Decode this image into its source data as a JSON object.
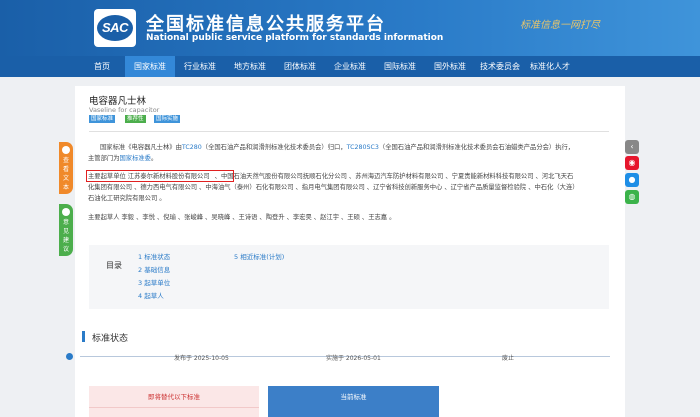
{
  "site": {
    "logo_text": "SAC",
    "title": "全国标准信息公共服务平台",
    "subtitle": "National public service platform  for standards information",
    "slogan": "标准信息一网打尽"
  },
  "nav": {
    "items": [
      {
        "label": "首页"
      },
      {
        "label": "国家标准"
      },
      {
        "label": "行业标准"
      },
      {
        "label": "地方标准"
      },
      {
        "label": "团体标准"
      },
      {
        "label": "企业标准"
      },
      {
        "label": "国际标准"
      },
      {
        "label": "国外标准"
      },
      {
        "label": "技术委员会"
      },
      {
        "label": "标准化人才"
      }
    ],
    "active_index": 1
  },
  "standard": {
    "title": "电容器凡士林",
    "title_en": "Vaseline for capacitor",
    "tags": [
      {
        "label": "国家标准",
        "color": "#3f94da"
      },
      {
        "label": "推荐性",
        "color": "#4cae4c"
      },
      {
        "label": "国际实施",
        "color": "#3f94da"
      }
    ],
    "intro": {
      "t1": "国家标准《电容器凡士林》由",
      "tc1": "TC280",
      "t2": "（全国石油产品和润滑剂标准化技术委员会）归口，",
      "tc2": "TC280SC3",
      "t3": "（全国石油产品和润滑剂标准化技术委员会石油蜡类产品分会）执行，",
      "t4": "主管部门为",
      "dept": "国家标准委",
      "t5": "。"
    },
    "drafting_units": {
      "highlighted": "主要起草单位 江苏泰尔新材料股份有限公司",
      "line1_rest": "、中国石油天然气股份有限公司抚顺石化分公司 、苏州海迈汽车防护材料有限公司 、宁夏贵能新材料科技有限公司 、河北飞天石",
      "line2": "化集团有限公司 、德力西电气有限公司 、中海油气（泰州）石化有限公司 、指月电气集团有限公司 、辽宁省科技创新服务中心 、辽宁省产品质量监督检验院 、中石化（大连）",
      "line3": "石油化工研究院有限公司 。"
    },
    "drafters": "主要起草人 李毅 、李悦 、倪瑜 、张峻峰 、吴晓峰 、王诗语 、陶登升 、李宏昊 、赵江宇 、王硕 、王志嘉 。"
  },
  "toc": {
    "label": "目录",
    "items": [
      {
        "label": "1  标准状态"
      },
      {
        "label": "2  基础信息"
      },
      {
        "label": "3  起草单位"
      },
      {
        "label": "4  起草人"
      },
      {
        "label": "5  相近标准(计划)"
      }
    ]
  },
  "status": {
    "heading": "标准状态",
    "timeline": [
      {
        "label": "发布于 2025-10-05"
      },
      {
        "label": "实施于 2026-05-01"
      },
      {
        "label": "废止"
      }
    ],
    "replaced_label": "即将替代以下标准",
    "current_label": "当前标准"
  },
  "sidebar": {
    "tab1": "查看文本",
    "tab2": "意见建议"
  },
  "share": [
    {
      "icon": "weibo-icon",
      "color": "#e6162d"
    },
    {
      "icon": "qq-icon",
      "color": "#1e8ee6"
    },
    {
      "icon": "wechat-icon",
      "color": "#3bb34a"
    }
  ]
}
